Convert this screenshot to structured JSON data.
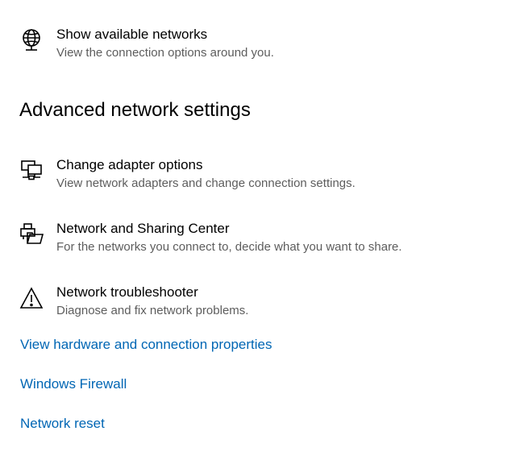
{
  "top_item": {
    "title": "Show available networks",
    "description": "View the connection options around you.",
    "icon": "globe-network-icon"
  },
  "advanced": {
    "heading": "Advanced network settings",
    "items": [
      {
        "title": "Change adapter options",
        "description": "View network adapters and change connection settings.",
        "icon": "network-adapter-icon"
      },
      {
        "title": "Network and Sharing Center",
        "description": "For the networks you connect to, decide what you want to share.",
        "icon": "sharing-center-icon"
      },
      {
        "title": "Network troubleshooter",
        "description": "Diagnose and fix network problems.",
        "icon": "warning-triangle-icon"
      }
    ]
  },
  "links": [
    "View hardware and connection properties",
    "Windows Firewall",
    "Network reset"
  ],
  "colors": {
    "link": "#0066b4",
    "description": "#5d5d5d",
    "text": "#000000",
    "background": "#ffffff"
  }
}
